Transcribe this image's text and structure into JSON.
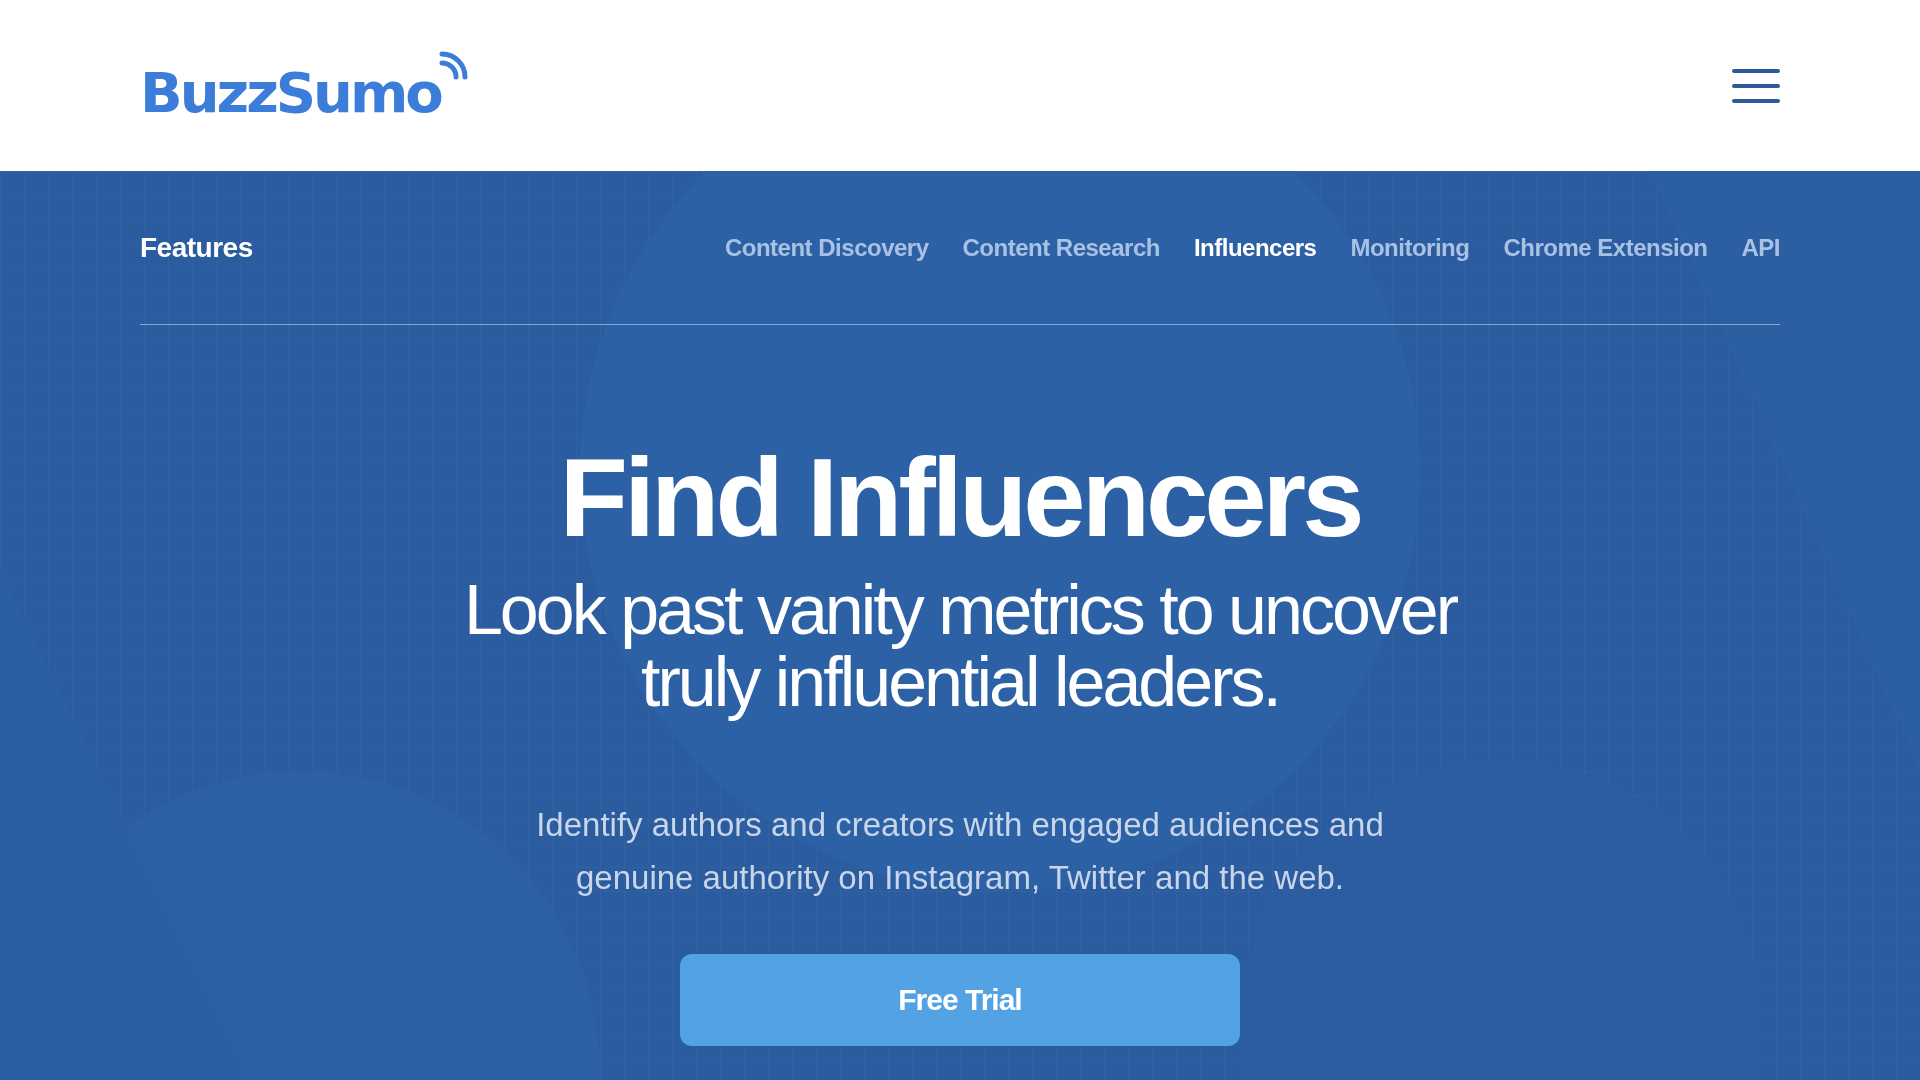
{
  "header": {
    "logo": "BuzzSumo"
  },
  "features_nav": {
    "title": "Features",
    "items": [
      {
        "label": "Content Discovery",
        "selected": false
      },
      {
        "label": "Content Research",
        "selected": false
      },
      {
        "label": "Influencers",
        "selected": true
      },
      {
        "label": "Monitoring",
        "selected": false
      },
      {
        "label": "Chrome Extension",
        "selected": false
      },
      {
        "label": "API",
        "selected": false
      }
    ]
  },
  "hero": {
    "title": "Find Influencers",
    "subtitle": "Look past vanity metrics to uncover truly influential leaders.",
    "description": "Identify authors and creators with engaged audiences and genuine authority on Instagram, Twitter and the web.",
    "button": "Free Trial"
  }
}
